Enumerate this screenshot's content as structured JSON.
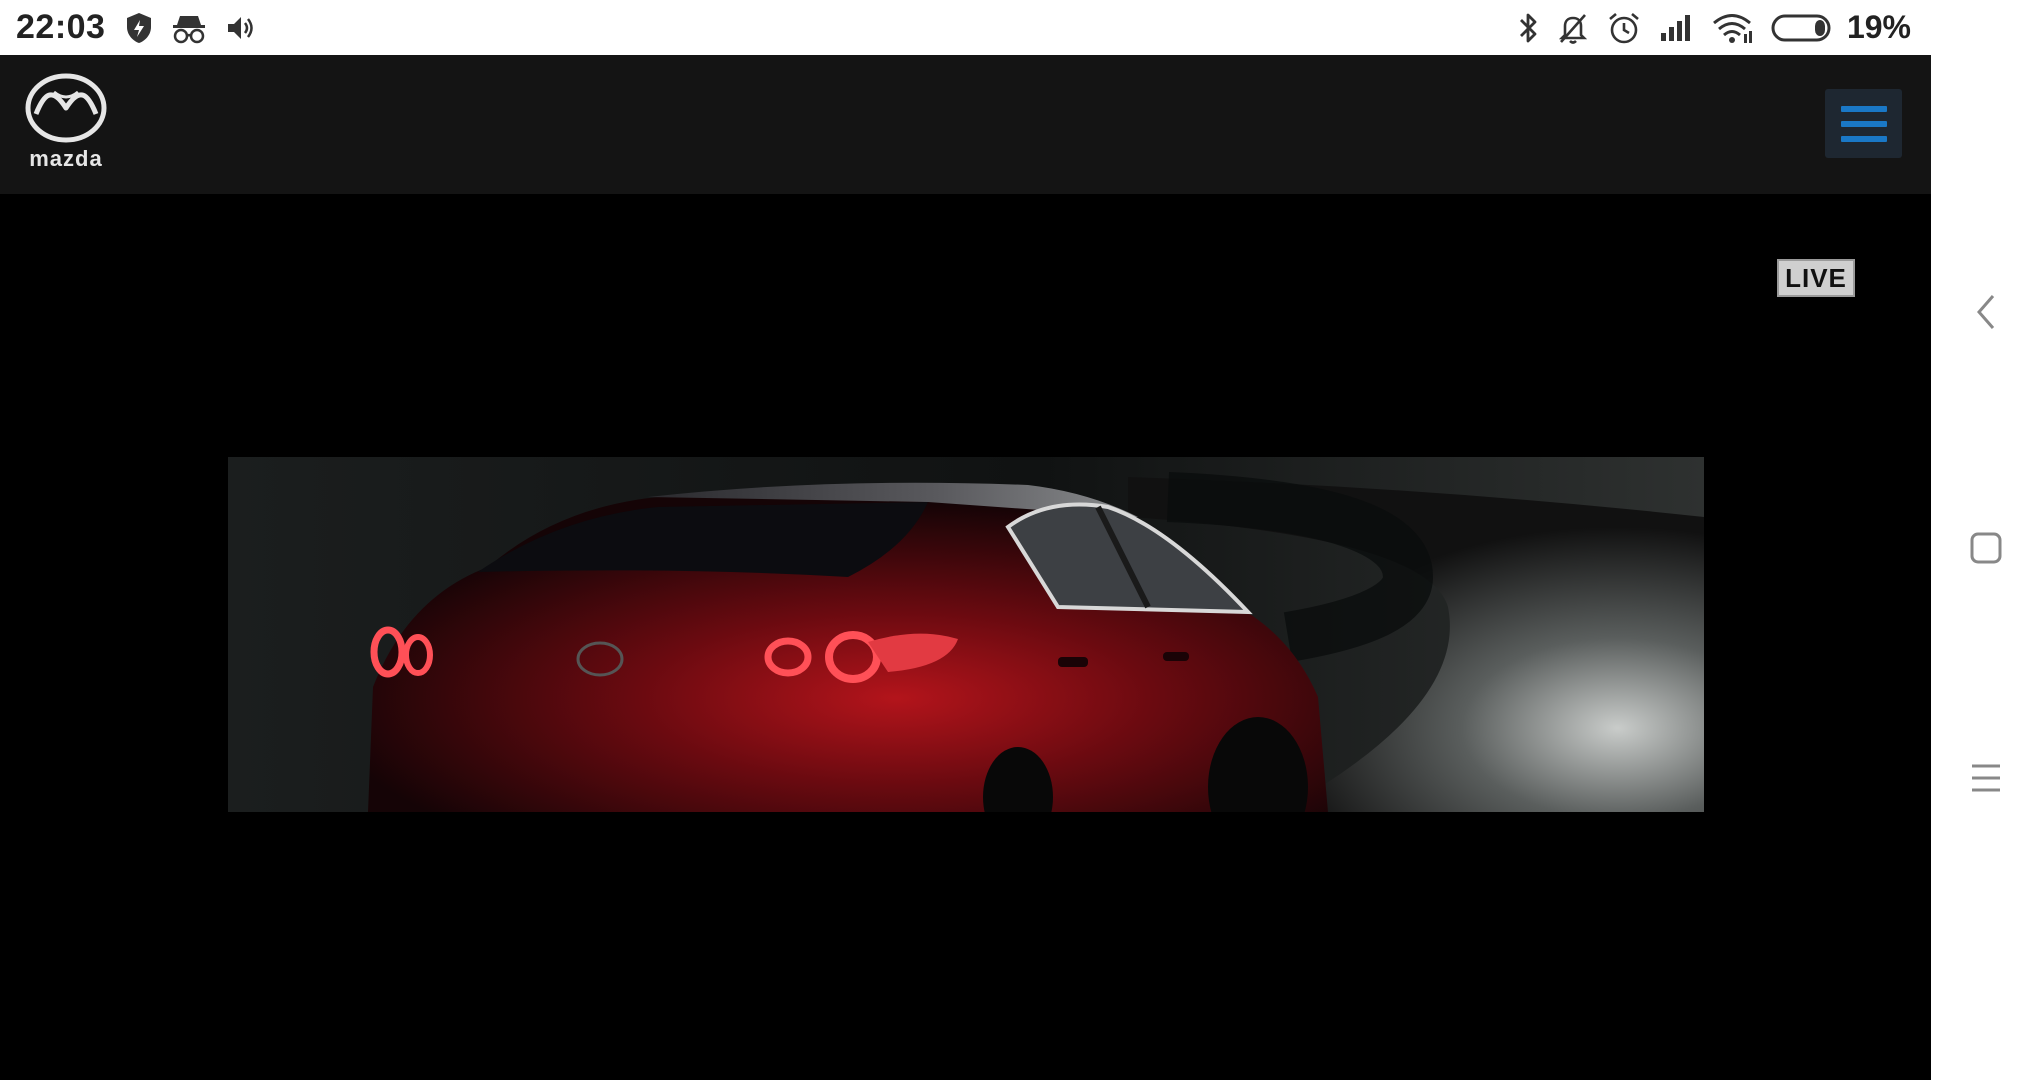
{
  "status_bar": {
    "time": "22:03",
    "battery_percent": "19%",
    "battery_level": 0.19,
    "left_icons": [
      "shield-icon",
      "incognito-icon",
      "volume-icon"
    ],
    "right_icons": [
      "bluetooth-icon",
      "bell-off-icon",
      "alarm-icon",
      "signal-icon",
      "wifi-icon",
      "battery-icon"
    ]
  },
  "header": {
    "brand": "mazda",
    "menu_icon": "hamburger-menu-icon",
    "menu_color": "#1a78c6"
  },
  "video": {
    "badge": "LIVE"
  },
  "nav_panel": {
    "buttons": [
      "back-icon",
      "home-icon",
      "recents-icon"
    ]
  }
}
